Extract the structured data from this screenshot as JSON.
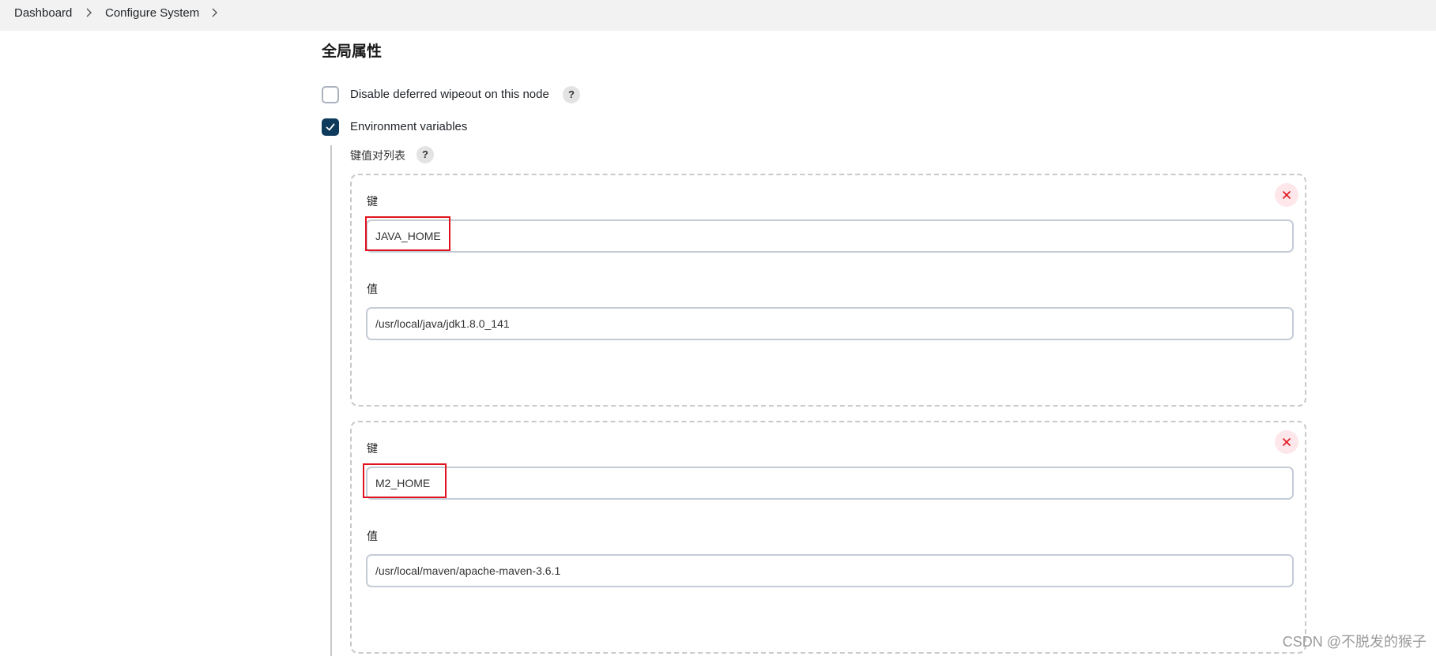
{
  "breadcrumb": {
    "items": [
      "Dashboard",
      "Configure System"
    ]
  },
  "section": {
    "title": "全局属性"
  },
  "options": {
    "disable_wipeout_label": "Disable deferred wipeout on this node",
    "disable_wipeout_checked": false,
    "env_vars_label": "Environment variables",
    "env_vars_checked": true
  },
  "env": {
    "list_title": "键值对列表",
    "help_glyph": "?",
    "entries": [
      {
        "key_label": "键",
        "key_value": "JAVA_HOME",
        "value_label": "值",
        "value_value": "/usr/local/java/jdk1.8.0_141"
      },
      {
        "key_label": "键",
        "key_value": "M2_HOME",
        "value_label": "值",
        "value_value": "/usr/local/maven/apache-maven-3.6.1"
      }
    ]
  },
  "watermark": "CSDN @不脱发的猴子",
  "colors": {
    "topbar_bg": "#f2f2f2",
    "checkbox_checked": "#0e3a5c",
    "highlight_red": "#e0141e",
    "remove_bg": "#fde7ea"
  },
  "icons": {
    "breadcrumb_separator": "chevron-right-icon",
    "checkbox_check": "check-icon",
    "help": "help-icon",
    "remove": "close-icon"
  }
}
